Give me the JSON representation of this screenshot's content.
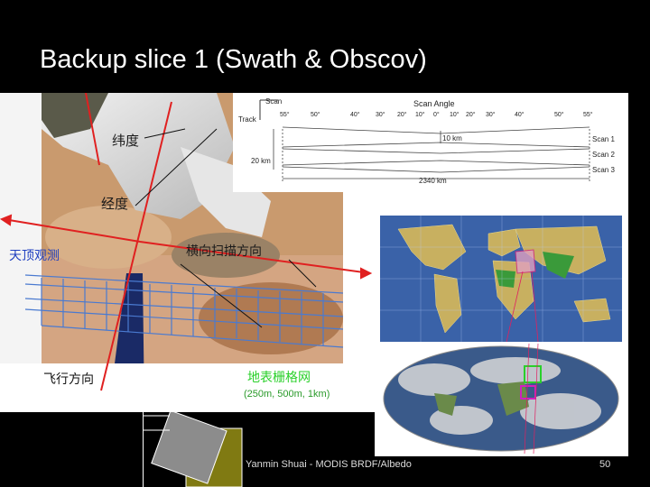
{
  "slide": {
    "title": "Backup slice 1  (Swath & Obscov)",
    "footer": "Yanmin Shuai - MODIS BRDF/Albedo",
    "page_number": "50"
  },
  "satellite_image": {
    "label_latitude": "纬度",
    "label_longitude": "经度",
    "label_nadir": "天顶观测",
    "label_scan_direction": "横向扫描方向",
    "label_flight_direction": "飞行方向",
    "label_grid": "地表栅格网",
    "label_grid_resolution": "(250m, 500m, 1km)"
  },
  "scan_diagram": {
    "scan_label": "Scan",
    "track_label": "Track",
    "scan_angle_label": "Scan Angle",
    "angle_ticks_left": [
      "55°",
      "50°",
      "40°",
      "30°",
      "20°",
      "10°",
      "0°"
    ],
    "angle_ticks_right": [
      "10°",
      "20°",
      "30°",
      "40°",
      "50°",
      "55°"
    ],
    "label_10km": "10 km",
    "label_20km": "20 km",
    "label_2340km": "2340 km",
    "scans": [
      "Scan 1",
      "Scan 2",
      "Scan 3"
    ]
  },
  "colors": {
    "background": "#000000",
    "arrow_red": "#e02020",
    "grid_blue": "#4a7ad0",
    "grid_label_green": "#2ad02a",
    "olive_square": "#807a12",
    "gray_square": "#8c8c8c"
  }
}
